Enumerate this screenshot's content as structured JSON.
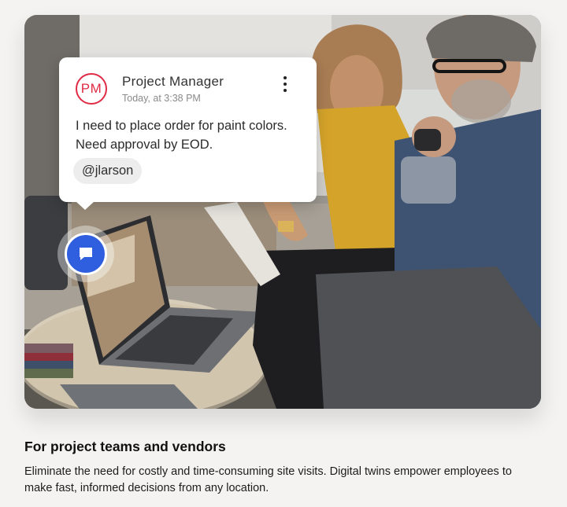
{
  "comment": {
    "avatar_initials": "PM",
    "author": "Project Manager",
    "timestamp": "Today, at 3:38 PM",
    "message": "I need to place order for paint colors. Need approval by EOD.",
    "mention": "@jlarson",
    "accent_color": "#e02b45"
  },
  "pin": {
    "icon": "comment-icon",
    "color": "#2f5fdf"
  },
  "section": {
    "title": "For project teams and vendors",
    "body": "Eliminate the need for costly and time-consuming site visits. Digital twins empower employees to make fast, informed decisions from any location."
  }
}
